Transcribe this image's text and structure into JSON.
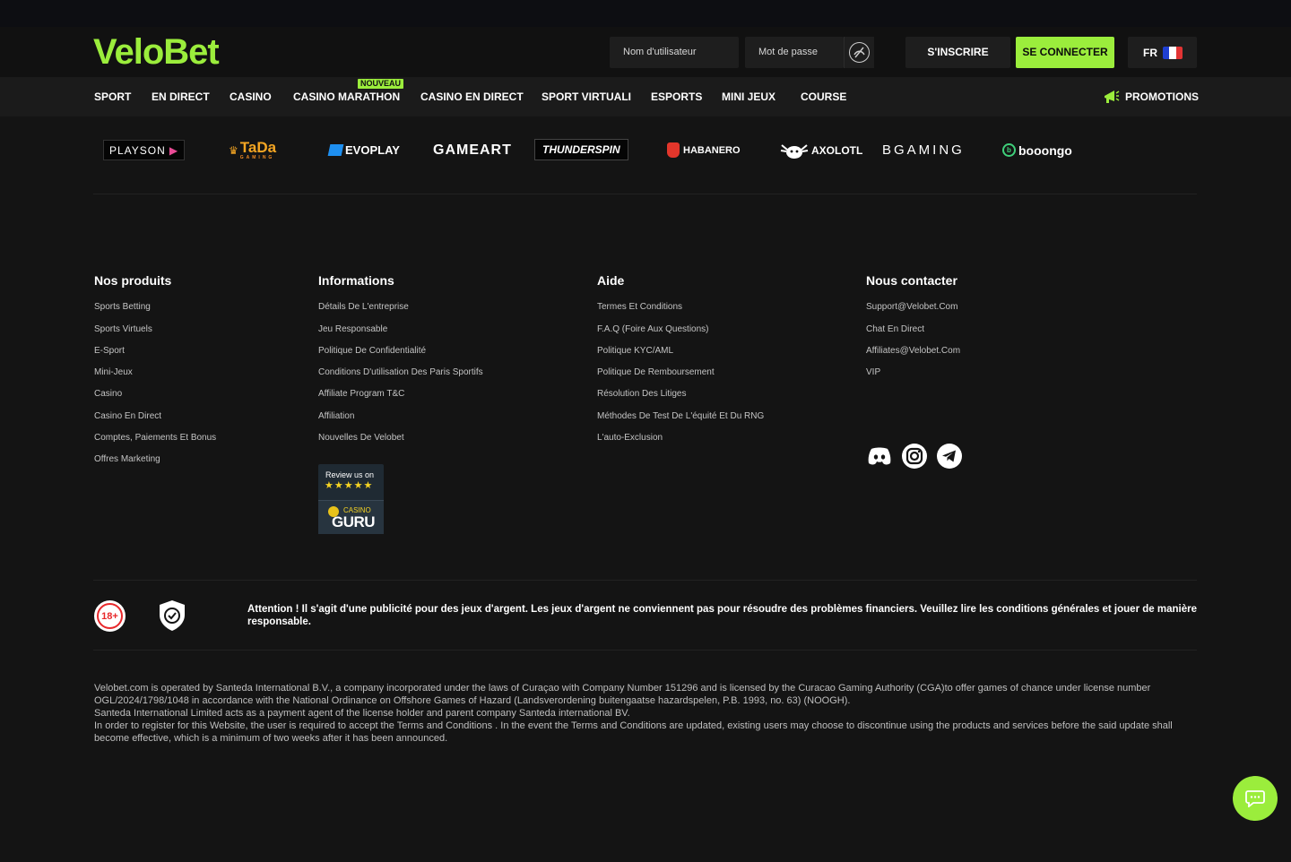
{
  "brand": {
    "logo": "VeloBet",
    "accent": "#9bed3c"
  },
  "login": {
    "username_placeholder": "Nom d'utilisateur",
    "password_placeholder": "Mot de passe",
    "register_label": "S'INSCRIRE",
    "login_label": "SE CONNECTER",
    "language": "FR"
  },
  "nav": {
    "items": [
      "SPORT",
      "EN DIRECT",
      "CASINO",
      "CASINO MARATHON",
      "CASINO EN DIRECT",
      "SPORT VIRTUALI",
      "ESPORTS",
      "MINI JEUX",
      "COURSE"
    ],
    "new_badge": "NOUVEAU",
    "promotions": "PROMOTIONS"
  },
  "providers": [
    "PLAYSON",
    "TaDa",
    "EVOPLAY",
    "GAMEART",
    "THUNDERSPIN",
    "HABANERO",
    "AXOLOTL",
    "BGAMING",
    "booongo"
  ],
  "provider_sub": {
    "tada": "GAMING"
  },
  "footer": {
    "columns": [
      {
        "title": "Nos produits",
        "links": [
          "Sports Betting",
          "Sports Virtuels",
          "E-Sport",
          "Mini-Jeux",
          "Casino",
          "Casino En Direct",
          "Comptes, Paiements Et Bonus",
          "Offres Marketing"
        ]
      },
      {
        "title": "Informations",
        "links": [
          "Détails De L'entreprise",
          "Jeu Responsable",
          "Politique De Confidentialité",
          "Conditions D'utilisation Des Paris Sportifs",
          "Affiliate Program T&C",
          "Affiliation",
          "Nouvelles De Velobet"
        ]
      },
      {
        "title": "Aide",
        "links": [
          "Termes Et Conditions",
          "F.A.Q (Foire Aux Questions)",
          "Politique KYC/AML",
          "Politique De Remboursement",
          "Résolution Des Litiges",
          "Méthodes De Test De L'équité Et Du RNG",
          "L'auto-Exclusion"
        ]
      },
      {
        "title": "Nous contacter",
        "links": [
          "Support@Velobet.Com",
          "Chat En Direct",
          "Affiliates@Velobet.Com",
          "VIP"
        ]
      }
    ],
    "review": {
      "line1": "Review us on",
      "stars": "★★★★★",
      "small": "CASINO",
      "big": "GURU"
    },
    "social": [
      "discord-icon",
      "instagram-icon",
      "telegram-icon"
    ]
  },
  "warning": {
    "age": "18+",
    "text": "Attention ! Il s'agit d'une publicité pour des jeux d'argent. Les jeux d'argent ne conviennent pas pour résoudre des problèmes financiers. Veuillez lire les conditions générales et jouer de manière responsable."
  },
  "legal": {
    "p1": "Velobet.com is operated by Santeda International B.V., a company incorporated under the laws of Curaçao with Company Number 151296 and is licensed by the Curacao Gaming Authority (CGA)to offer games of chance under license number OGL/2024/1798/1048 in accordance with the National Ordinance on Offshore Games of Hazard (Landsverordening buitengaatse hazardspelen, P.B. 1993, no. 63) (NOOGH).",
    "p2": "Santeda International Limited acts as a payment agent of the license holder and parent company Santeda international BV.",
    "p3": "In order to register for this Website, the user is required to accept the Terms and Conditions . In the event the Terms and Conditions are updated, existing users may choose to discontinue using the products and services before the said update shall become effective, which is a minimum of two weeks after it has been announced."
  }
}
